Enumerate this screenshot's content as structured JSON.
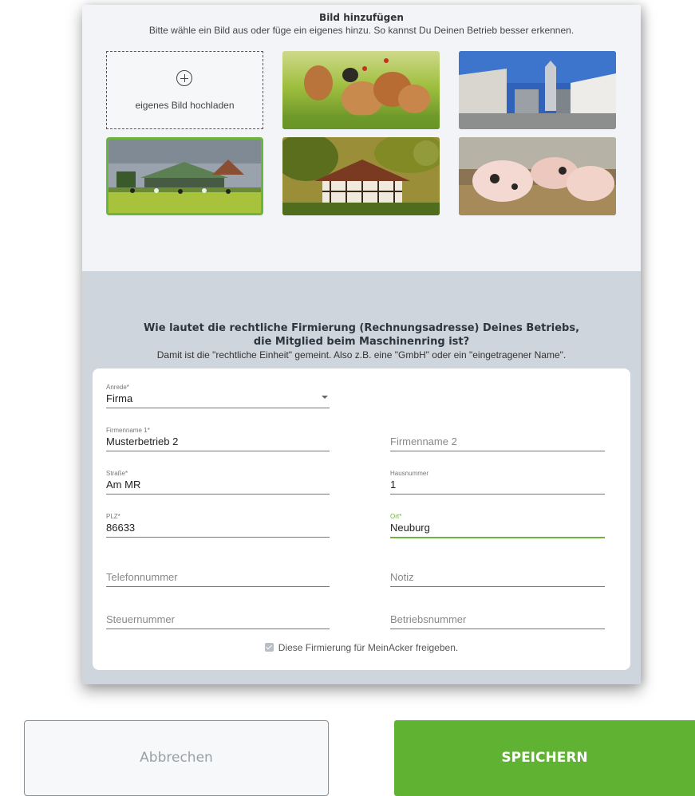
{
  "image_picker": {
    "title": "Bild hinzufügen",
    "subtitle": "Bitte wähle ein Bild aus oder füge ein eigenes hinzu. So kannst Du Deinen Betrieb besser erkennen.",
    "upload_label": "eigenes Bild hochladen",
    "selected_index": 3,
    "images": [
      "chickens-photo",
      "farm-silo-photo",
      "farm-barn-cows-photo",
      "timber-frame-farmhouse-photo",
      "piglets-photo"
    ],
    "accent_color": "#6cb33f"
  },
  "form": {
    "heading_line1": "Wie lautet die rechtliche Firmierung (Rechnungsadresse) Deines Betriebs,",
    "heading_line2": "die Mitglied beim Maschinenring ist?",
    "subheading": "Damit ist die \"rechtliche Einheit\" gemeint. Also z.B. eine \"GmbH\" oder ein \"eingetragener Name\".",
    "anrede": {
      "label": "Anrede*",
      "value": "Firma"
    },
    "firmenname1": {
      "label": "Firmenname 1*",
      "value": "Musterbetrieb 2"
    },
    "firmenname2": {
      "placeholder": "Firmenname 2"
    },
    "strasse": {
      "label": "Straße*",
      "value": "Am MR"
    },
    "hausnummer": {
      "label": "Hausnummer",
      "value": "1"
    },
    "plz": {
      "label": "PLZ*",
      "value": "86633"
    },
    "ort": {
      "label": "Ort*",
      "value": "Neuburg"
    },
    "telefon": {
      "placeholder": "Telefonnummer"
    },
    "notiz": {
      "placeholder": "Notiz"
    },
    "steuer": {
      "placeholder": "Steuernummer"
    },
    "betrieb": {
      "placeholder": "Betriebsnummer"
    },
    "checkbox_label": "Diese Firmierung für MeinAcker freigeben.",
    "checkbox_checked": true
  },
  "buttons": {
    "cancel": "Abbrechen",
    "save": "SPEICHERN",
    "save_color": "#5fb232"
  }
}
